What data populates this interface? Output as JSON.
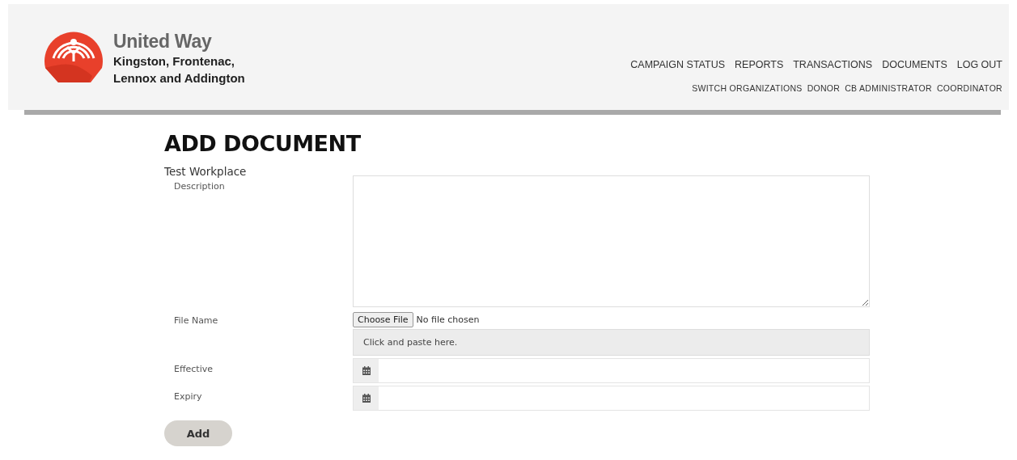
{
  "header": {
    "logo": {
      "name": "United Way",
      "region_lines": [
        "Kingston, Frontenac,",
        "Lennox and Addington"
      ]
    },
    "primary_nav": [
      "CAMPAIGN STATUS",
      "REPORTS",
      "TRANSACTIONS",
      "DOCUMENTS",
      "LOG OUT"
    ],
    "secondary_nav": [
      "SWITCH ORGANIZATIONS",
      "DONOR",
      "CB ADMINISTRATOR",
      "COORDINATOR"
    ]
  },
  "page_title": "ADD DOCUMENT",
  "organization": "Test Workplace",
  "fields": [
    {
      "kind": "textarea",
      "label": "Description"
    },
    {
      "kind": "file",
      "label": "File Name",
      "button": "Choose File",
      "status": "No file chosen",
      "paste_hint": "Click and paste here."
    },
    {
      "kind": "date",
      "label": "Effective"
    },
    {
      "kind": "date",
      "label": "Expiry"
    }
  ],
  "submit": "Add"
}
